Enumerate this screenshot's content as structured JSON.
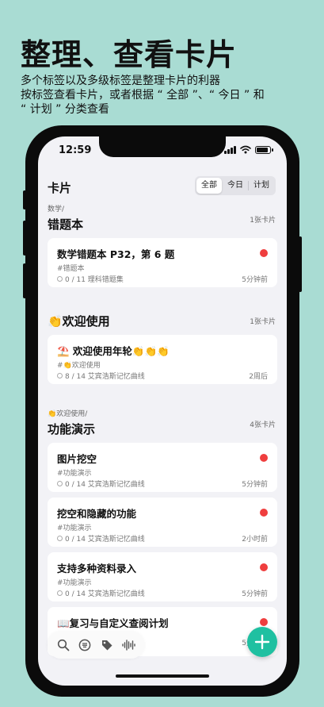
{
  "promo": {
    "title": "整理、查看卡片",
    "subtitle_line1": "多个标签以及多级标签是整理卡片的利器",
    "subtitle_line2": "按标签查看卡片，或者根据 “ 全部 ”、“ 今日 ” 和",
    "subtitle_line3": "“ 计划 ” 分类查看"
  },
  "status_bar": {
    "time": "12:59",
    "battery_level": 0.9
  },
  "nav": {
    "title": "卡片"
  },
  "segments": [
    {
      "label": "全部",
      "active": true
    },
    {
      "label": "今日",
      "active": false
    },
    {
      "label": "计划",
      "active": false
    }
  ],
  "groups": [
    {
      "path": "数学/",
      "title": "错题本",
      "count": "1张卡片",
      "cards": [
        {
          "title": "数学错题本 P32，第 6 题",
          "tag": "#错题本",
          "meta": "0 / 11 理科错题集",
          "time": "5分钟前",
          "due": true
        }
      ]
    },
    {
      "path": "",
      "title": "👏欢迎使用",
      "count": "1张卡片",
      "cards": [
        {
          "title": "⛱️ 欢迎使用年轮👏👏👏",
          "tag": "#👏欢迎使用",
          "meta": "8 / 14 艾宾浩斯记忆曲线",
          "time": "2周后",
          "due": false
        }
      ]
    },
    {
      "path": "👏欢迎使用/",
      "title": "功能演示",
      "count": "4张卡片",
      "cards": [
        {
          "title": "图片挖空",
          "tag": "#功能演示",
          "meta": "0 / 14 艾宾浩斯记忆曲线",
          "time": "5分钟前",
          "due": true
        },
        {
          "title": "挖空和隐藏的功能",
          "tag": "#功能演示",
          "meta": "0 / 14 艾宾浩斯记忆曲线",
          "time": "2小时前",
          "due": true
        },
        {
          "title": "支持多种资料录入",
          "tag": "#功能演示",
          "meta": "0 / 14 艾宾浩斯记忆曲线",
          "time": "5分钟前",
          "due": true
        },
        {
          "title": "📖复习与自定义查阅计划",
          "tag": "",
          "meta": "",
          "time": "5分钟前",
          "due": true
        }
      ]
    }
  ],
  "toolbar": {
    "icons": [
      "search-icon",
      "list-icon",
      "tag-icon",
      "waveform-icon"
    ]
  },
  "fab": {
    "icon": "plus-icon"
  }
}
